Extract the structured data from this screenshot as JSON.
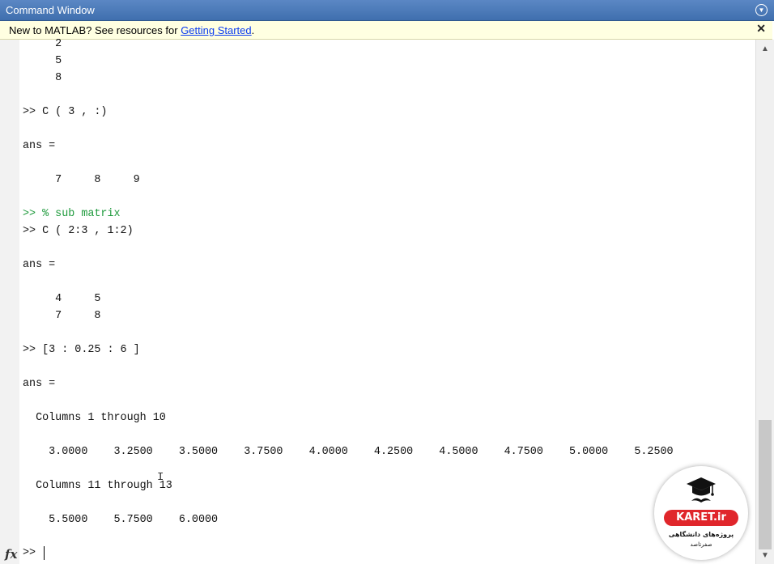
{
  "window": {
    "title": "Command Window"
  },
  "banner": {
    "prefix": "New to MATLAB? See resources for ",
    "link": "Getting Started",
    "suffix": ".",
    "close": "✕"
  },
  "lines": [
    {
      "text": "     2",
      "type": "output"
    },
    {
      "text": "     5",
      "type": "output"
    },
    {
      "text": "     8",
      "type": "output"
    },
    {
      "text": ">> C ( 3 , :)",
      "type": "command"
    },
    {
      "text": "ans =",
      "type": "output"
    },
    {
      "text": "     7     8     9",
      "type": "output"
    },
    {
      "text": ">> % sub matrix",
      "type": "comment"
    },
    {
      "text": ">> C ( 2:3 , 1:2)",
      "type": "command"
    },
    {
      "text": "ans =",
      "type": "output"
    },
    {
      "text": "     4     5",
      "type": "output"
    },
    {
      "text": "     7     8",
      "type": "output"
    },
    {
      "text": ">> [3 : 0.25 : 6 ]",
      "type": "command"
    },
    {
      "text": "ans =",
      "type": "output"
    },
    {
      "text": "  Columns 1 through 10",
      "type": "output"
    },
    {
      "text": "    3.0000    3.2500    3.5000    3.7500    4.0000    4.2500    4.5000    4.7500    5.0000    5.2500",
      "type": "output"
    },
    {
      "text": "  Columns 11 through 13",
      "type": "output"
    },
    {
      "text": "    5.5000    5.7500    6.0000",
      "type": "output"
    }
  ],
  "prompt": {
    "fx": "fx",
    "text": ">>"
  },
  "logo": {
    "brand": "KARET.ir",
    "line1": "پروژه‌های دانشگاهی",
    "line2": "صفرتاصد"
  }
}
